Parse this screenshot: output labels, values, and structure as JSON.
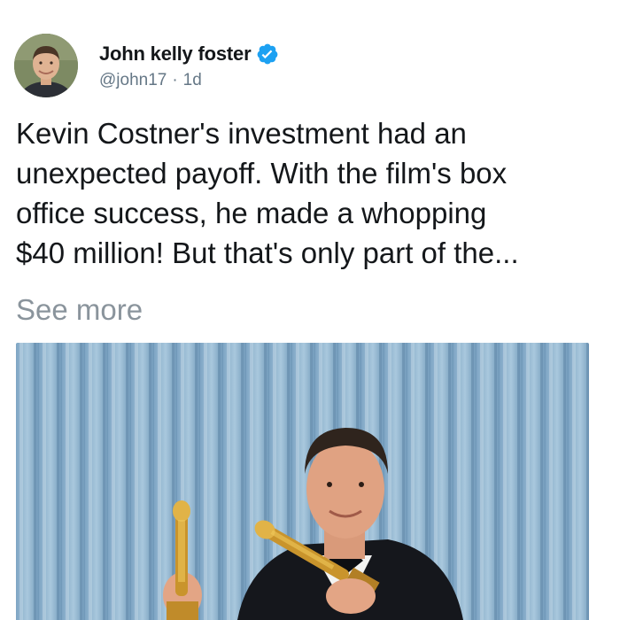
{
  "tweet": {
    "author": {
      "display_name": "John kelly foster",
      "handle": "@john17",
      "separator": "·",
      "timestamp": "1d",
      "verified": true
    },
    "text_lines": [
      "Kevin Costner's investment had an",
      "unexpected payoff. With the film's box",
      "office success, he made a whopping",
      "$40 million! But that's only part of the..."
    ],
    "see_more_label": "See more",
    "media": {
      "icon": "photo-man-holding-two-statuettes"
    }
  },
  "colors": {
    "text_primary": "#14171a",
    "text_secondary": "#657786",
    "see_more": "#8a949c",
    "verified_badge": "#1da1f2",
    "curtain": "#8fb3cf"
  }
}
